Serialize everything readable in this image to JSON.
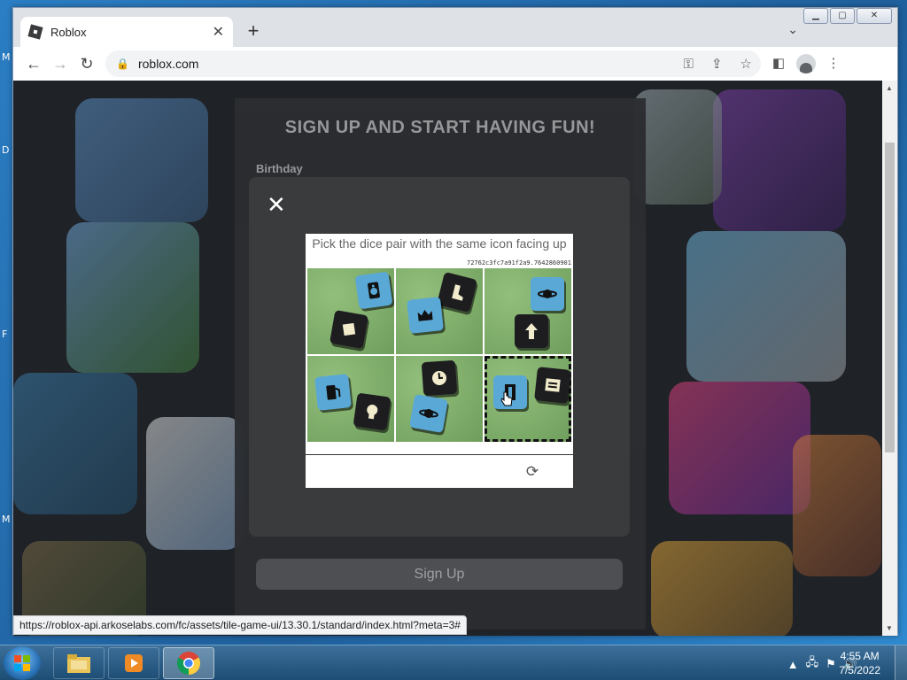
{
  "browser": {
    "tab_title": "Roblox",
    "tab_close": "✕",
    "new_tab": "+",
    "tab_search": "⌄",
    "url": "roblox.com",
    "status_url": "https://roblox-api.arkoselabs.com/fc/assets/tile-game-ui/13.30.1/standard/index.html?meta=3#",
    "icons": {
      "back": "←",
      "forward": "→",
      "reload": "↻",
      "lock": "🔒",
      "key": "⚿",
      "share": "⇪",
      "bookmark": "☆",
      "sidepanel": "◧",
      "menu": "⋮"
    }
  },
  "page": {
    "signup_title": "SIGN UP AND START HAVING FUN!",
    "birthday_label": "Birthday",
    "signup_button": "Sign Up"
  },
  "modal": {
    "close": "✕",
    "captcha": {
      "title": "Pick the dice pair with the same icon facing up",
      "hash": "72762c3fc7a91f2a9.7642860901",
      "refresh": "⟳",
      "tiles": [
        {
          "id": 1,
          "selected": false
        },
        {
          "id": 2,
          "selected": false
        },
        {
          "id": 3,
          "selected": false
        },
        {
          "id": 4,
          "selected": false
        },
        {
          "id": 5,
          "selected": false
        },
        {
          "id": 6,
          "selected": true
        }
      ]
    }
  },
  "taskbar": {
    "clock_time": "4:55 AM",
    "clock_date": "7/5/2022",
    "apps": [
      "windows-explorer",
      "media-player",
      "chrome"
    ]
  },
  "desktop_letters": [
    "M",
    "D",
    "F",
    "M"
  ],
  "colors": {
    "modal_bg": "#393b3d",
    "signup_bg": "#2b2d31",
    "die_blue": "#5aa8d6",
    "die_black": "#1d1d20",
    "felt_green": "#7fae6c"
  }
}
